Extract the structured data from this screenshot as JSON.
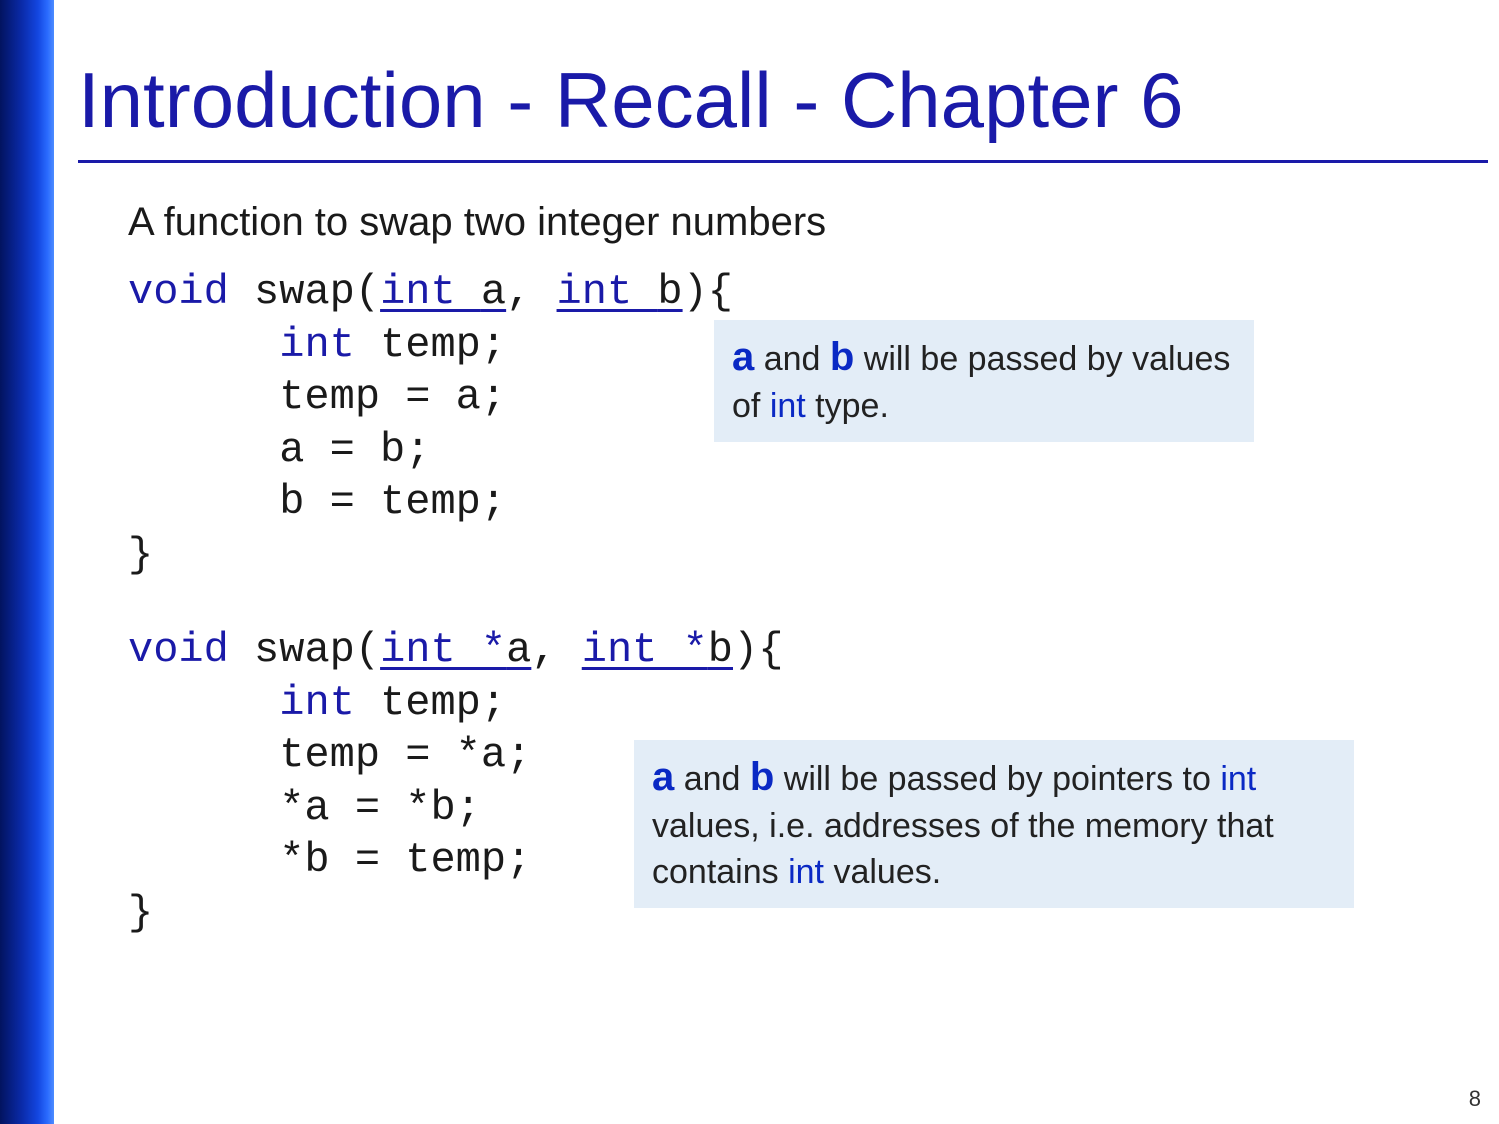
{
  "title": "Introduction - Recall - Chapter 6",
  "subtitle": "A function to swap two integer numbers",
  "code_block_1": {
    "sig_pre": "void",
    "sig_name": "swap(",
    "param1": "int ",
    "param1_var": "a",
    "sig_sep": ", ",
    "param2": "int ",
    "param2_var": "b",
    "sig_post": "){",
    "l2a": "int",
    "l2b": " temp;",
    "l3": "      temp = a;",
    "l4": "      a = b;",
    "l5": "      b = temp;",
    "l6": "}"
  },
  "code_block_2": {
    "sig_pre": "void",
    "sig_name": "swap(",
    "param1": "int *",
    "param1_var": "a",
    "sig_sep": ", ",
    "param2": "int *",
    "param2_var": "b",
    "sig_post": "){",
    "l2a": "int",
    "l2b": " temp;",
    "l3": "      temp = *a;",
    "l4": "      *a = *b;",
    "l5": "      *b = temp;",
    "l6": "}"
  },
  "callout1": {
    "v1": "a",
    "t1": " and ",
    "v2": "b",
    "t2": " will be passed by values of ",
    "kw": "int",
    "t3": " type."
  },
  "callout2": {
    "v1": "a",
    "t1": " and ",
    "v2": "b",
    "t2": " will be passed by pointers to ",
    "kw1": "int",
    "t3": " values, i.e. addresses of the memory that contains ",
    "kw2": "int",
    "t4": " values."
  },
  "page_number": "8"
}
